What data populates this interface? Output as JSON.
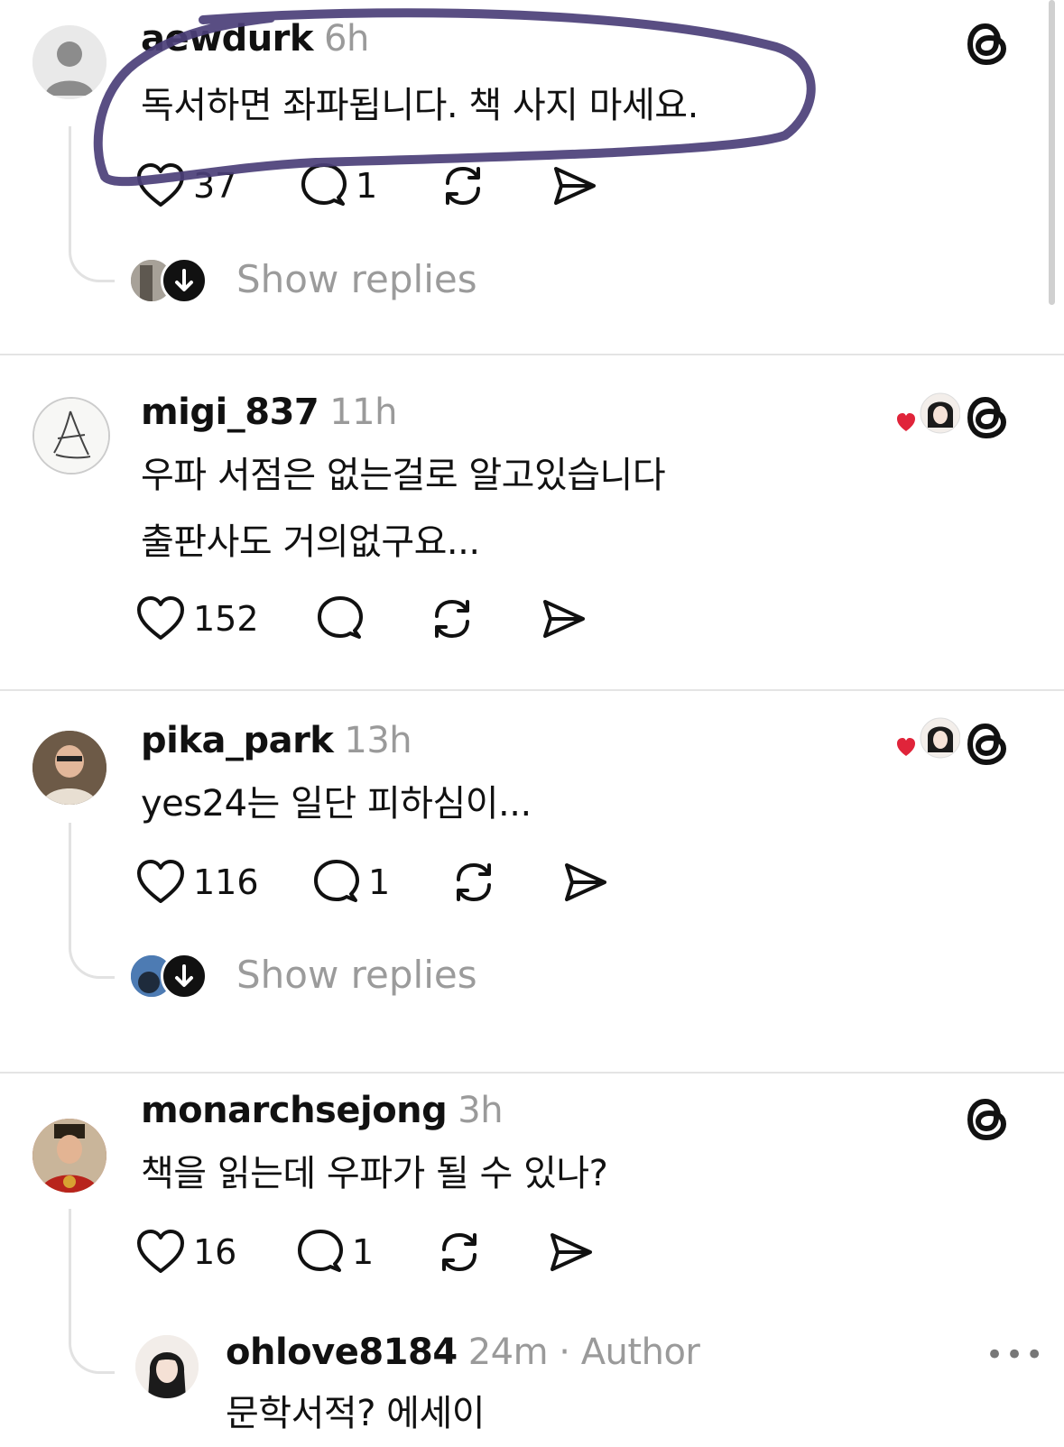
{
  "colors": {
    "text": "#111111",
    "muted": "#9a9a9a",
    "divider": "#e4e4e4",
    "heart_red": "#e0243a",
    "highlight_ink": "#4b3f78"
  },
  "posts": [
    {
      "username": "aewdurk",
      "time": "6h",
      "lines": [
        "독서하면 좌파됩니다. 책 사지 마세요."
      ],
      "likes": "37",
      "comments": "1",
      "show_replies": "Show replies",
      "avatar_icon": "default-person-avatar"
    },
    {
      "username": "migi_837",
      "time": "11h",
      "lines": [
        "우파 서점은 없는걸로 알고있습니다",
        "출판사도 거의없구요..."
      ],
      "likes": "152",
      "comments": "",
      "avatar_icon": "sketch-avatar"
    },
    {
      "username": "pika_park",
      "time": "13h",
      "lines": [
        "yes24는 일단 피하심이..."
      ],
      "likes": "116",
      "comments": "1",
      "show_replies": "Show replies",
      "avatar_icon": "photo-avatar"
    },
    {
      "username": "monarchsejong",
      "time": "3h",
      "lines": [
        "책을 읽는데 우파가 될 수 있나?"
      ],
      "likes": "16",
      "comments": "1",
      "avatar_icon": "king-avatar"
    }
  ],
  "reply": {
    "username": "ohlove8184",
    "meta": "24m · Author",
    "text": "문학서적? 에세이",
    "more": "•••"
  }
}
